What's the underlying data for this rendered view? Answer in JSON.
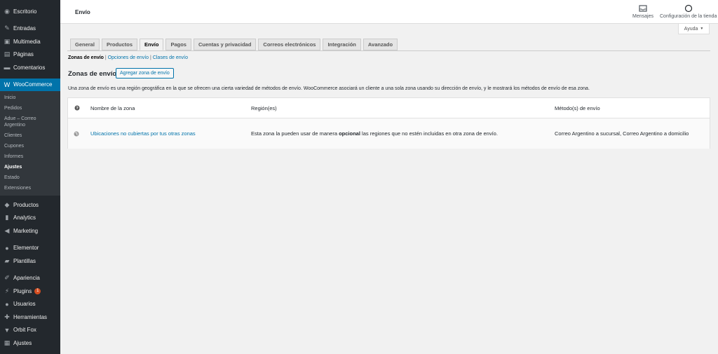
{
  "sidebar": {
    "top_items": [
      {
        "label": "Escritorio",
        "icon": "dashboard-icon"
      },
      {
        "label": "Entradas",
        "icon": "pin-icon"
      },
      {
        "label": "Multimedia",
        "icon": "media-icon"
      },
      {
        "label": "Páginas",
        "icon": "page-icon"
      },
      {
        "label": "Comentarios",
        "icon": "comment-icon"
      }
    ],
    "woocommerce": {
      "label": "WooCommerce",
      "icon": "woocommerce-icon"
    },
    "sub_items": [
      "Inicio",
      "Pedidos",
      "Adue – Correo Argentino",
      "Clientes",
      "Cupones",
      "Informes",
      "Ajustes",
      "Estado",
      "Extensiones"
    ],
    "bottom_items": [
      {
        "label": "Productos",
        "icon": "box-icon"
      },
      {
        "label": "Analytics",
        "icon": "chart-icon"
      },
      {
        "label": "Marketing",
        "icon": "megaphone-icon"
      },
      {
        "label": "Elementor",
        "icon": "elementor-icon"
      },
      {
        "label": "Plantillas",
        "icon": "folder-icon"
      },
      {
        "label": "Apariencia",
        "icon": "brush-icon"
      },
      {
        "label": "Plugins",
        "icon": "plug-icon",
        "badge": "1"
      },
      {
        "label": "Usuarios",
        "icon": "user-icon"
      },
      {
        "label": "Herramientas",
        "icon": "wrench-icon"
      },
      {
        "label": "Orbit Fox",
        "icon": "fox-icon"
      },
      {
        "label": "Ajustes",
        "icon": "settings-icon"
      }
    ]
  },
  "header": {
    "title": "Envío",
    "messages_label": "Mensajes",
    "store_setup_label": "Configuración de la tienda",
    "help_label": "Ayuda"
  },
  "tabs": [
    "General",
    "Productos",
    "Envío",
    "Pagos",
    "Cuentas y privacidad",
    "Correos electrónicos",
    "Integración",
    "Avanzado"
  ],
  "subsections": {
    "current": "Zonas de envío",
    "options": "Opciones de envío",
    "classes": "Clases de envío",
    "sep": "|"
  },
  "section": {
    "heading": "Zonas de envío",
    "add_button": "Agregar zona de envío",
    "description": "Una zona de envío es una región geográfica en la que se ofrecen una cierta variedad de métodos de envío. WooCommerce asociará un cliente a una sola zona usando su dirección de envío, y le mostrará los métodos de envío de esa zona."
  },
  "table": {
    "headers": {
      "name": "Nombre de la zona",
      "region": "Región(es)",
      "methods": "Método(s) de envío"
    },
    "rows": [
      {
        "name": "Ubicaciones no cubiertas por tus otras zonas",
        "region_pre": "Esta zona la pueden usar de manera",
        "region_bold": "opcional",
        "region_post": "las regiones que no estén incluidas en otra zona de envío.",
        "methods": "Correo Argentino a sucursal, Correo Argentino a domicilio"
      }
    ]
  },
  "colors": {
    "accent": "#0073aa",
    "sidebar": "#23282d",
    "badge": "#d54e21"
  }
}
